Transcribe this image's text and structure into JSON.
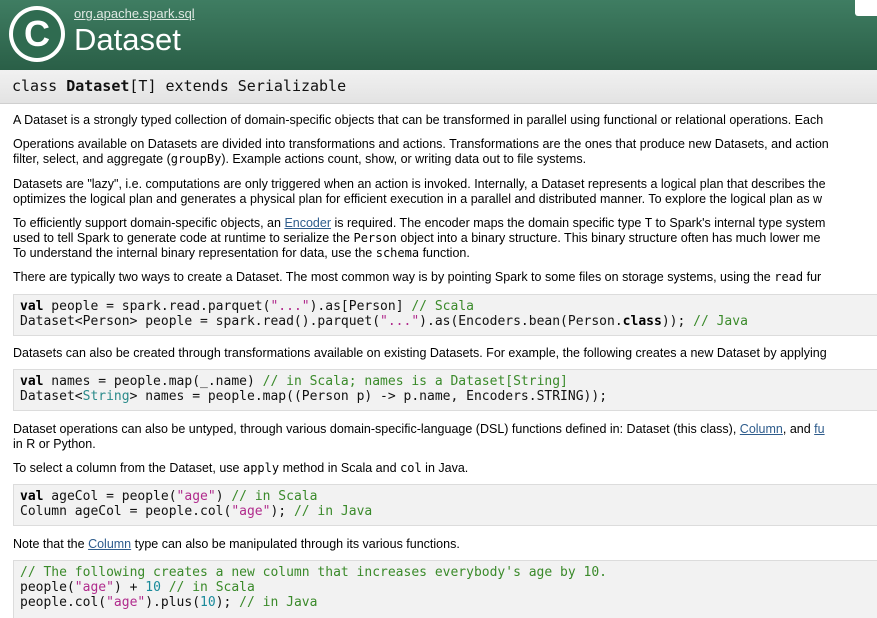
{
  "header": {
    "logo_letter": "C",
    "package": "org.apache.spark.sql",
    "title": "Dataset"
  },
  "signature": {
    "prefix": "class ",
    "name": "Dataset",
    "rest": "[T] extends Serializable"
  },
  "p1": "A Dataset is a strongly typed collection of domain-specific objects that can be transformed in parallel using functional or relational operations. Each",
  "p2": {
    "line1": "Operations available on Datasets are divided into transformations and actions. Transformations are the ones that produce new Datasets, and action",
    "line2_a": "filter, select, and aggregate (",
    "line2_code": "groupBy",
    "line2_b": "). Example actions count, show, or writing data out to file systems."
  },
  "p3": {
    "line1": "Datasets are \"lazy\", i.e. computations are only triggered when an action is invoked. Internally, a Dataset represents a logical plan that describes the",
    "line2": "optimizes the logical plan and generates a physical plan for efficient execution in a parallel and distributed manner. To explore the logical plan as w"
  },
  "p4": {
    "line1_a": "To efficiently support domain-specific objects, an ",
    "line1_link": "Encoder",
    "line1_b": " is required. The encoder maps the domain specific type ",
    "line1_code": "T",
    "line1_c": " to Spark's internal type system",
    "line2_a": "used to tell Spark to generate code at runtime to serialize the ",
    "line2_code": "Person",
    "line2_b": " object into a binary structure. This binary structure often has much lower me",
    "line3_a": "To understand the internal binary representation for data, use the ",
    "line3_code": "schema",
    "line3_b": " function."
  },
  "p5": {
    "text": "There are typically two ways to create a Dataset. The most common way is by pointing Spark to some files on storage systems, using the ",
    "code": "read",
    "tail": " fur"
  },
  "code1": {
    "l1_kw": "val",
    "l1_a": " people = spark.read.parquet(",
    "l1_str": "\"...\"",
    "l1_b": ").as[Person]  ",
    "l1_cm": "// Scala",
    "l2_a": "Dataset<Person> people = spark.read().parquet(",
    "l2_str": "\"...\"",
    "l2_b": ").as(Encoders.bean(Person.",
    "l2_kw": "class",
    "l2_c": ")); ",
    "l2_cm": "// Java"
  },
  "p6": "Datasets can also be created through transformations available on existing Datasets. For example, the following creates a new Dataset by applying",
  "code2": {
    "l1_kw": "val",
    "l1_a": " names = people.map(_.name)  ",
    "l1_cm": "// in Scala; names is a Dataset[String]",
    "l2_a": "Dataset<",
    "l2_typ": "String",
    "l2_b": "> names = people.map((Person p) -> p.name, Encoders.STRING));"
  },
  "p7": {
    "line1_a": "Dataset operations can also be untyped, through various domain-specific-language (DSL) functions defined in: Dataset (this class), ",
    "line1_link1": "Column",
    "line1_b": ", and ",
    "line1_link2": "fu",
    "line2": "in R or Python."
  },
  "p8": {
    "a": "To select a column from the Dataset, use ",
    "code1": "apply",
    "b": " method in Scala and ",
    "code2": "col",
    "c": " in Java."
  },
  "code3": {
    "l1_kw": "val",
    "l1_a": " ageCol = people(",
    "l1_str": "\"age\"",
    "l1_b": ")  ",
    "l1_cm": "// in Scala",
    "l2_a": "Column ageCol = people.col(",
    "l2_str": "\"age\"",
    "l2_b": "); ",
    "l2_cm": "// in Java"
  },
  "p9": {
    "a": "Note that the ",
    "link": "Column",
    "b": " type can also be manipulated through its various functions."
  },
  "code4": {
    "l1_cm": "// The following creates a new column that increases everybody's age by 10.",
    "l2_a": "people(",
    "l2_str": "\"age\"",
    "l2_b": ") + ",
    "l2_num": "10",
    "l2_c": "  ",
    "l2_cm": "// in Scala",
    "l3_a": "people.col(",
    "l3_str": "\"age\"",
    "l3_b": ").plus(",
    "l3_num": "10",
    "l3_c": ");  ",
    "l3_cm": "// in Java"
  }
}
